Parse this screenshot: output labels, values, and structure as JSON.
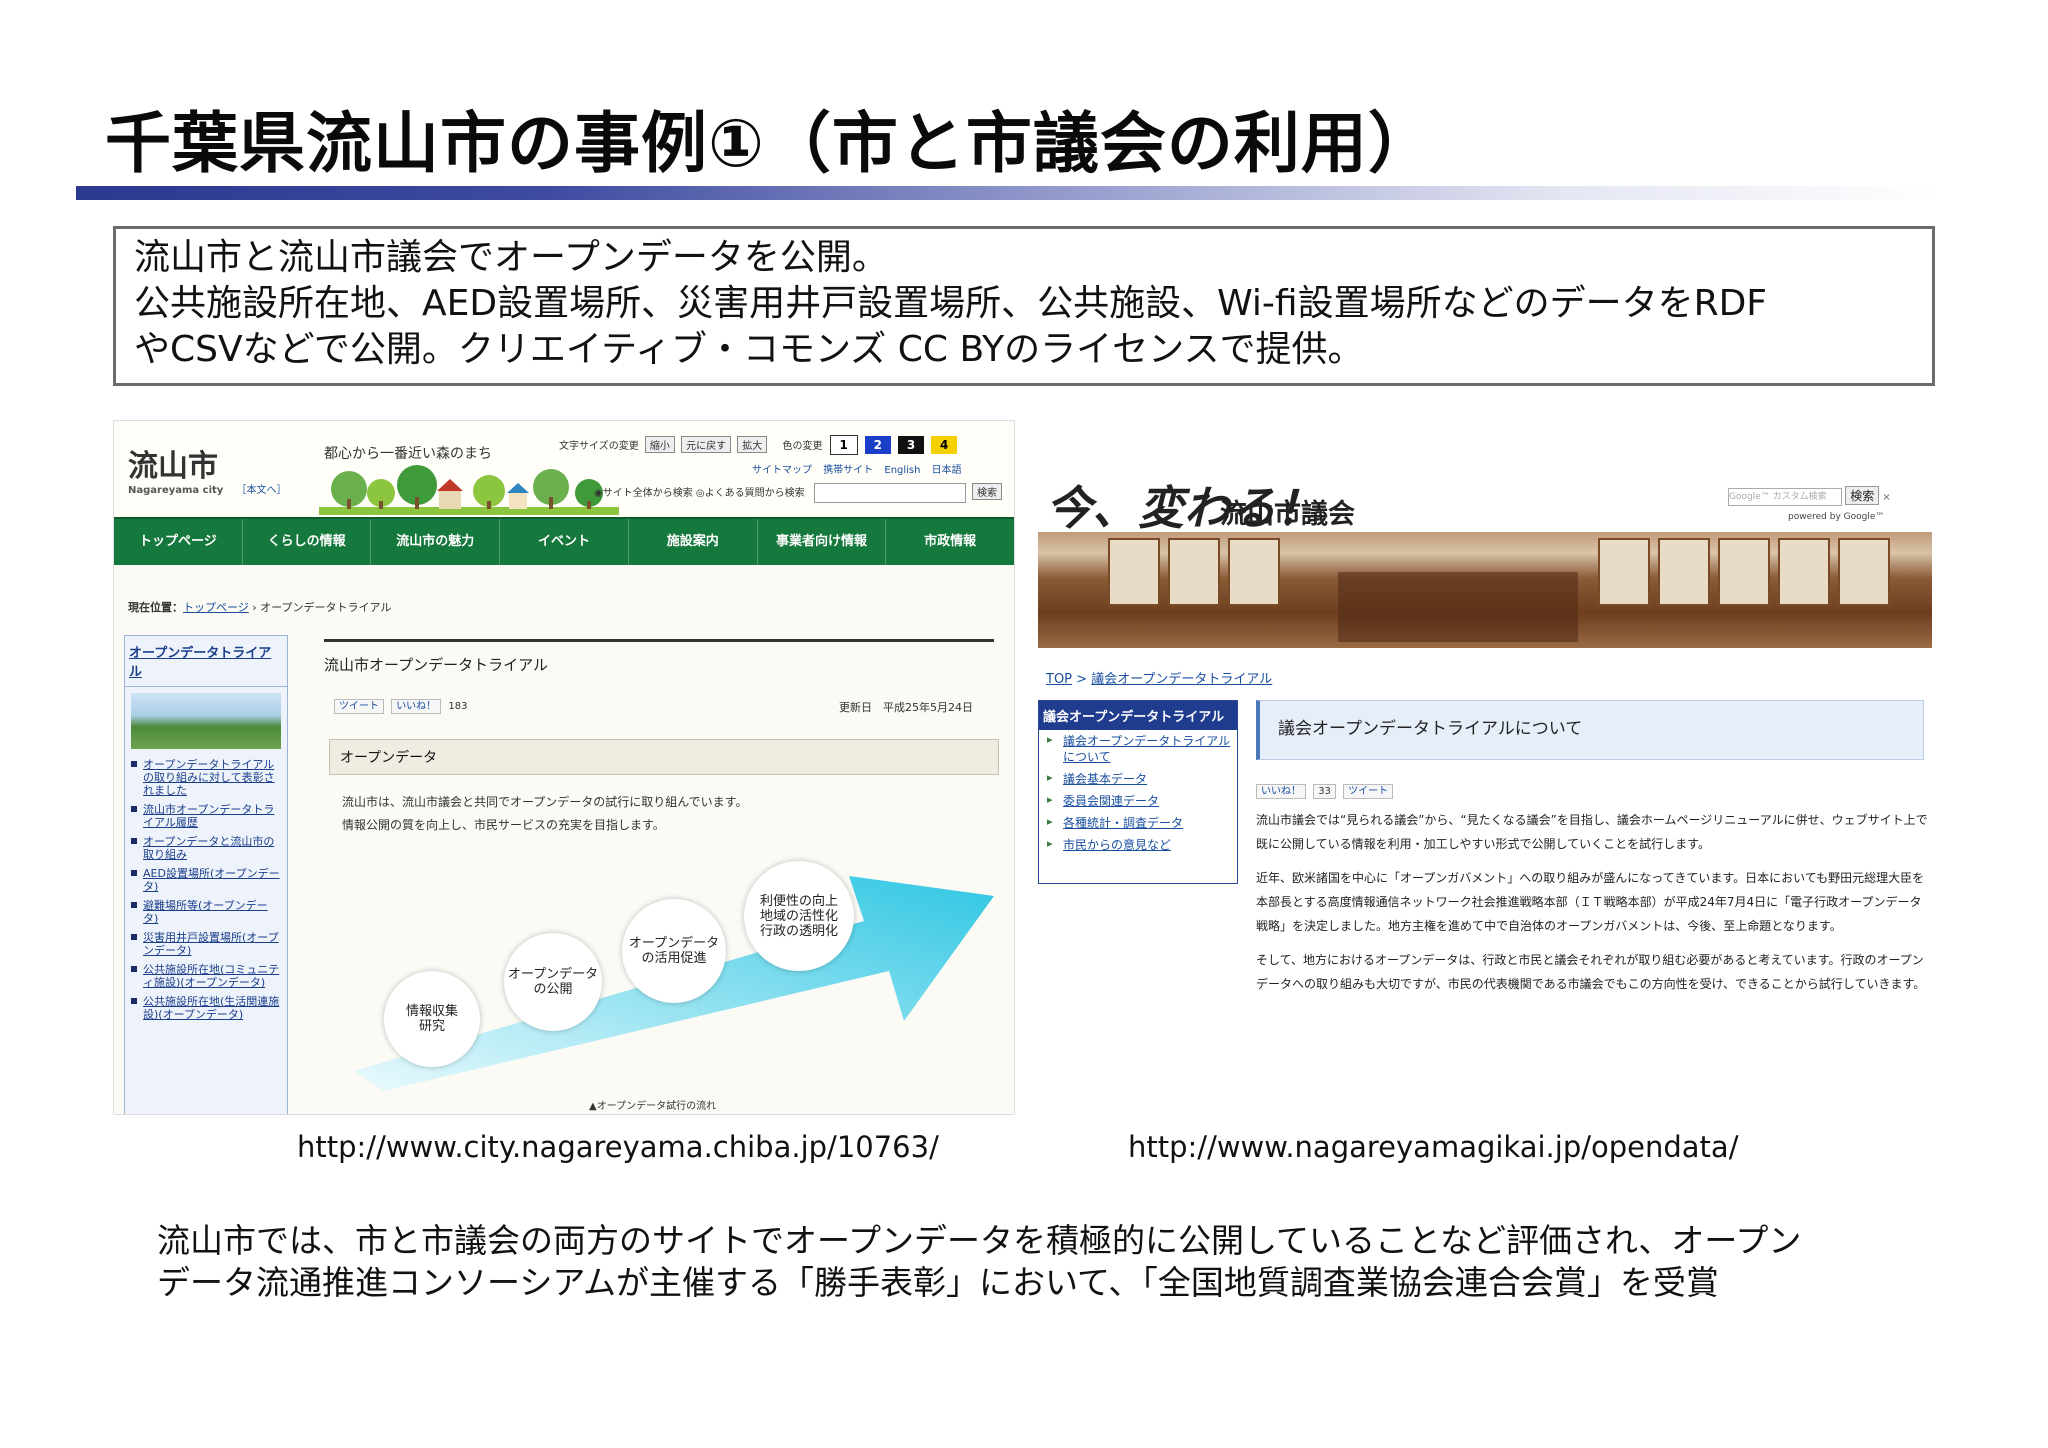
{
  "slide": {
    "title": "千葉県流山市の事例①（市と市議会の利用）",
    "intro_lines": [
      "流山市と流山市議会でオープンデータを公開。",
      "公共施設所在地、AED設置場所、災害用井戸設置場所、公共施設、Wi-fi設置場所などのデータをRDF",
      "やCSVなどで公開。クリエイティブ・コモンズ CC BYのライセンスで提供。"
    ],
    "url_left": "http://www.city.nagareyama.chiba.jp/10763/",
    "url_right": "http://www.nagareyamagikai.jp/opendata/",
    "summary_lines": [
      "流山市では、市と市議会の両方のサイトでオープンデータを積極的に公開していることなど評価され、オープン",
      "データ流通推進コンソーシアムが主催する「勝手表彰」において、「全国地質調査業協会連合会賞」を受賞"
    ]
  },
  "city_site": {
    "logo": "流山市",
    "logo_en": "Nagareyama city",
    "logo_link": "［本文へ］",
    "tagline": "都心から一番近い森のまち",
    "font_size_label": "文字サイズの変更",
    "font_buttons": [
      "縮小",
      "元に戻す",
      "拡大"
    ],
    "color_label": "色の変更",
    "color_buttons": [
      "1",
      "2",
      "3",
      "4"
    ],
    "util_links": [
      "サイトマップ",
      "携帯サイト",
      "English",
      "日本語"
    ],
    "search_scope": "◉サイト全体から検索 ◎よくある質問から検索",
    "search_button": "検索",
    "nav": [
      "トップページ",
      "くらしの情報",
      "流山市の魅力",
      "イベント",
      "施設案内",
      "事業者向け情報",
      "市政情報"
    ],
    "breadcrumb_prefix": "現在位置：",
    "breadcrumb_link": "トップページ",
    "breadcrumb_current": " › オープンデータトライアル",
    "side_heading": "オープンデータトライアル",
    "side_items": [
      "オープンデータトライアルの取り組みに対して表彰されました",
      "流山市オープンデータトライアル履歴",
      "オープンデータと流山市の取り組み",
      "AED設置場所(オープンデータ)",
      "避難場所等(オープンデータ)",
      "災害用井戸設置場所(オープンデータ)",
      "公共施設所在地(コミュニティ施設)(オープンデータ)",
      "公共施設所在地(生活関連施設)(オープンデータ)"
    ],
    "page_heading": "流山市オープンデータトライアル",
    "tweet": "ツイート",
    "like": "いいね！",
    "like_count": "183",
    "updated": "更新日　平成25年5月24日",
    "section": "オープンデータ",
    "body_lines": [
      "流山市は、流山市議会と共同でオープンデータの試行に取り組んでいます。",
      "情報公開の質を向上し、市民サービスの充実を目指します。"
    ],
    "bubbles": [
      "情報収集\n研究",
      "オープンデータ\nの公開",
      "オープンデータ\nの活用促進",
      "利便性の向上\n地域の活性化\n行政の透明化"
    ],
    "figure_caption": "▲オープンデータ試行の流れ"
  },
  "council_site": {
    "logo": "今、変わる！",
    "name": "流山市議会",
    "search_placeholder": "Google™ カスタム検索",
    "search_button": "検索",
    "powered": "powered by Google™",
    "breadcrumb_top": "TOP",
    "breadcrumb_link": "議会オープンデータトライアル",
    "side_heading": "議会オープンデータトライアル",
    "side_items": [
      "議会オープンデータトライアルについて",
      "議会基本データ",
      "委員会関連データ",
      "各種統計・調査データ",
      "市民からの意見など"
    ],
    "heading": "議会オープンデータトライアルについて",
    "like": "いいね！",
    "like_count": "33",
    "tweet": "ツイート",
    "paragraphs": [
      "流山市議会では“見られる議会”から、“見たくなる議会”を目指し、議会ホームページリニューアルに併せ、ウェブサイト上で既に公開している情報を利用・加工しやすい形式で公開していくことを試行します。",
      "近年、欧米諸国を中心に「オープンガバメント」への取り組みが盛んになってきています。日本においても野田元総理大臣を本部長とする高度情報通信ネットワーク社会推進戦略本部（ＩＴ戦略本部）が平成24年7月4日に「電子行政オープンデータ戦略」を決定しました。地方主権を進めて中で自治体のオープンガバメントは、今後、至上命題となります。",
      "そして、地方におけるオープンデータは、行政と市民と議会それぞれが取り組む必要があると考えています。行政のオープンデータへの取り組みも大切ですが、市民の代表機関である市議会でもこの方向性を受け、できることから試行していきます。"
    ]
  },
  "colors": {
    "title_bar_start": "#2b3990",
    "nav_green": "#15783c",
    "council_blue": "#1f3c8f"
  }
}
